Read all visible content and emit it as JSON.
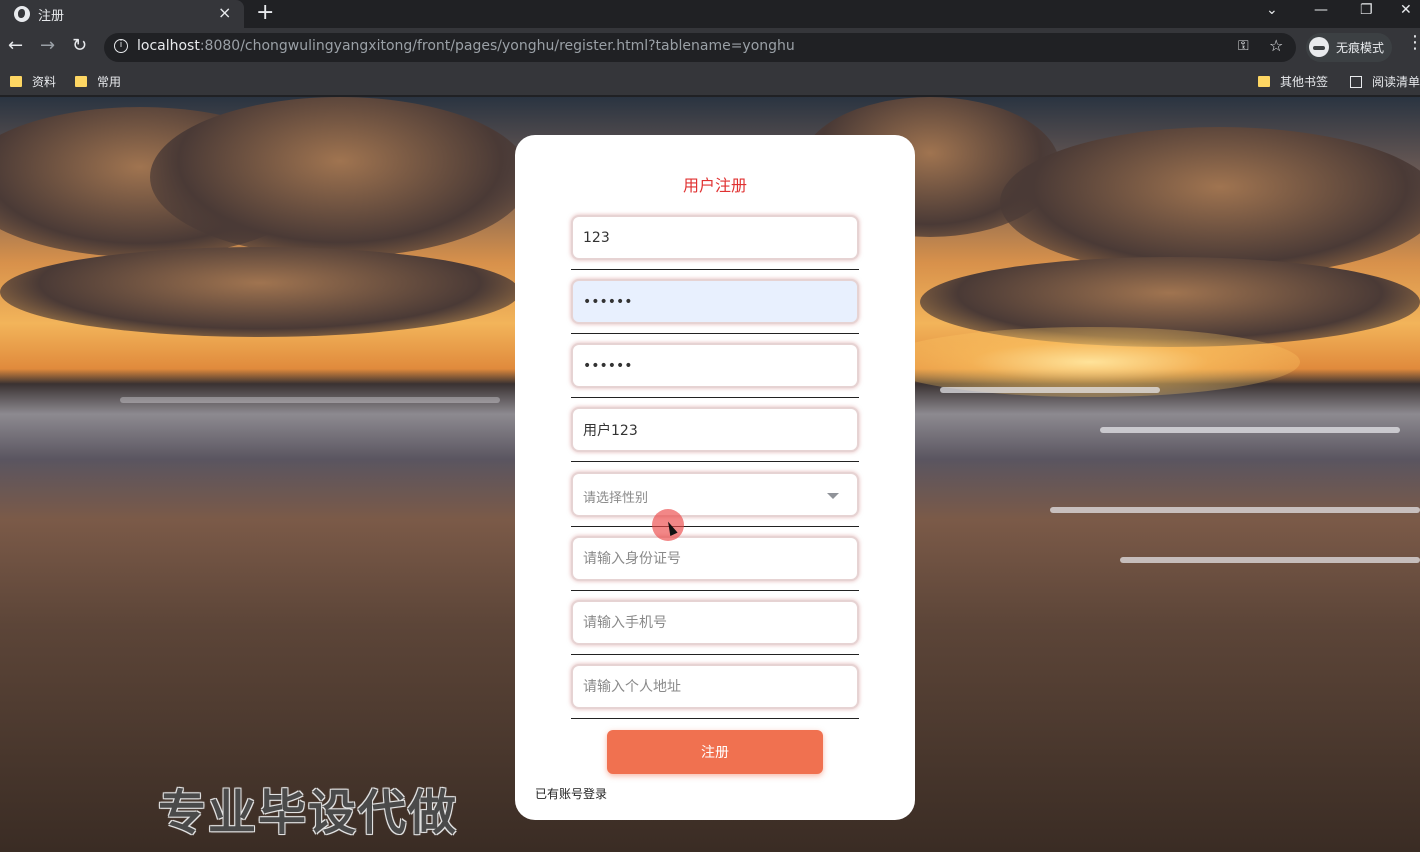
{
  "browser": {
    "tab_title": "注册",
    "tab_close": "×",
    "new_tab": "+",
    "url_host": "localhost",
    "url_rest": ":8080/chongwulingyangxitong/front/pages/yonghu/register.html?tablename=yonghu",
    "incognito_label": "无痕模式",
    "bookmarks": [
      "资料",
      "常用"
    ],
    "other_bookmarks": "其他书签",
    "reading_list": "阅读清单"
  },
  "form": {
    "title": "用户注册",
    "username_value": "123",
    "password_value": "123456",
    "confirm_password_value": "123456",
    "name_value": "用户123",
    "gender_placeholder": "请选择性别",
    "id_card_placeholder": "请输入身份证号",
    "phone_placeholder": "请输入手机号",
    "address_placeholder": "请输入个人地址",
    "submit_label": "注册",
    "login_link": "已有账号登录"
  },
  "watermark": "专业毕设代做",
  "colors": {
    "title": "#e03232",
    "button": "#f07150",
    "card": "#ffffff"
  }
}
